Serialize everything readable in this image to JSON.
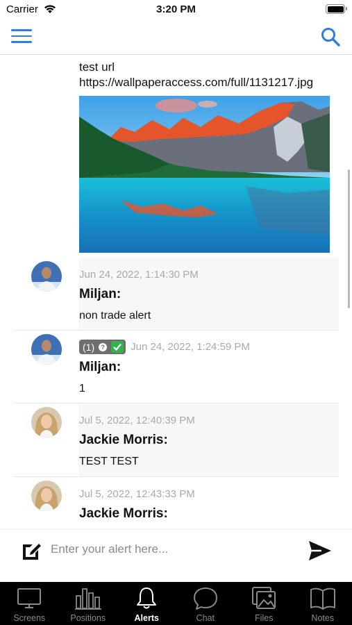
{
  "status_bar": {
    "carrier": "Carrier",
    "time": "3:20 PM"
  },
  "nav": {
    "menu_icon": "hamburger-icon",
    "search_icon": "search-icon",
    "accent_color": "#2f7de1"
  },
  "feed": {
    "url_post": {
      "line1": "test url",
      "line2": "https://wallpaperaccess.com/full/1131217.jpg"
    },
    "messages": [
      {
        "timestamp": "Jun 24, 2022, 1:14:30 PM",
        "author": "Miljan:",
        "text": "non trade alert"
      },
      {
        "badge_count": "(1)",
        "timestamp": "Jun 24, 2022, 1:24:59 PM",
        "author": "Miljan:",
        "text": "1"
      },
      {
        "timestamp": "Jul 5, 2022, 12:40:39 PM",
        "author": "Jackie Morris:",
        "text": "TEST TEST"
      },
      {
        "timestamp": "Jul 5, 2022, 12:43:33 PM",
        "author": "Jackie Morris:"
      }
    ]
  },
  "composer": {
    "placeholder": "Enter your alert here...",
    "compose_icon": "compose-icon",
    "send_icon": "send-icon"
  },
  "tabs": [
    {
      "label": "Screens",
      "icon": "monitor-icon"
    },
    {
      "label": "Positions",
      "icon": "bar-chart-icon"
    },
    {
      "label": "Alerts",
      "icon": "bell-icon",
      "active": true
    },
    {
      "label": "Chat",
      "icon": "chat-bubble-icon"
    },
    {
      "label": "Files",
      "icon": "images-icon"
    },
    {
      "label": "Notes",
      "icon": "book-icon"
    }
  ]
}
